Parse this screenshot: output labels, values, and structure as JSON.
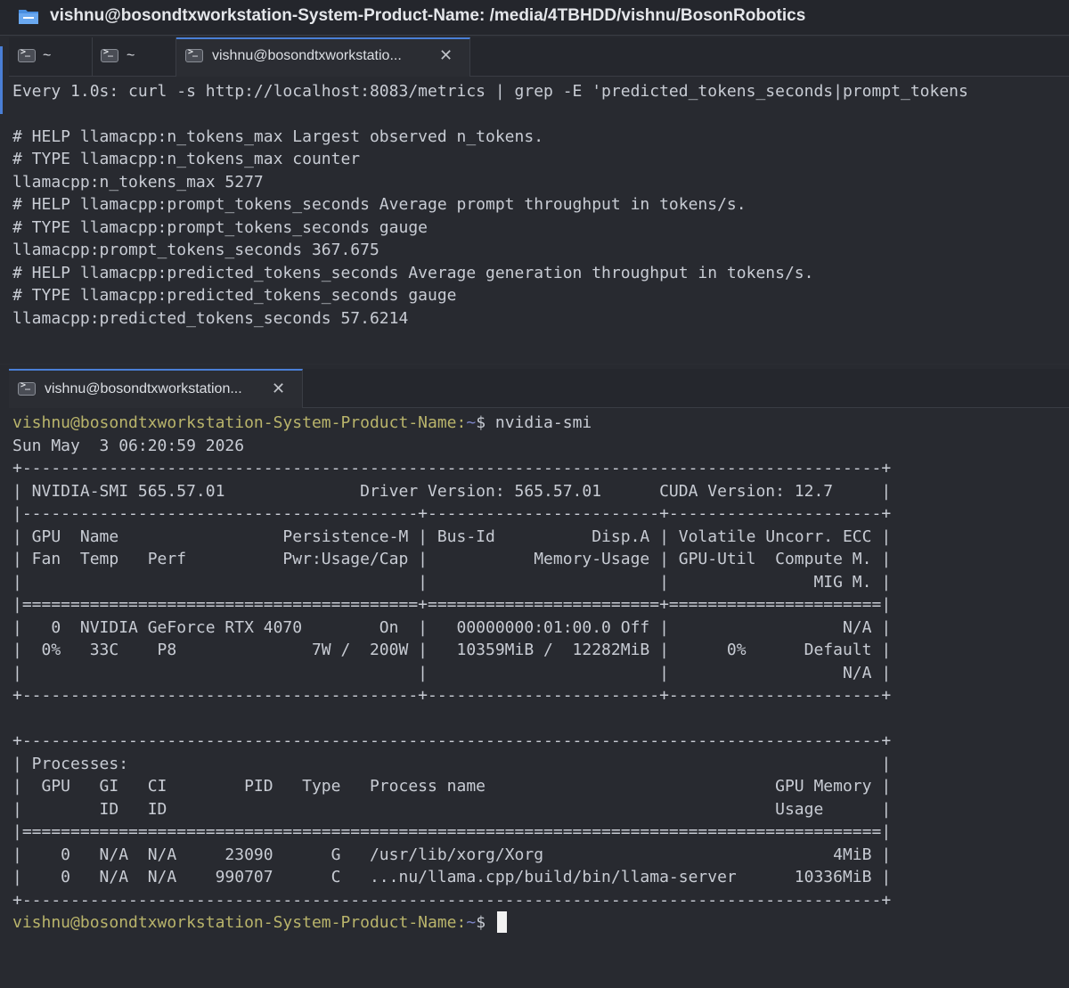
{
  "window": {
    "title": "vishnu@bosondtxworkstation-System-Product-Name: /media/4TBHDD/vishnu/BosonRobotics"
  },
  "top_tabs": [
    {
      "label": "~"
    },
    {
      "label": "~"
    },
    {
      "label": "vishnu@bosondtxworkstatio...",
      "close": "✕"
    }
  ],
  "top_pane": {
    "lines": [
      "Every 1.0s: curl -s http://localhost:8083/metrics | grep -E 'predicted_tokens_seconds|prompt_tokens",
      "",
      "# HELP llamacpp:n_tokens_max Largest observed n_tokens.",
      "# TYPE llamacpp:n_tokens_max counter",
      "llamacpp:n_tokens_max 5277",
      "# HELP llamacpp:prompt_tokens_seconds Average prompt throughput in tokens/s.",
      "# TYPE llamacpp:prompt_tokens_seconds gauge",
      "llamacpp:prompt_tokens_seconds 367.675",
      "# HELP llamacpp:predicted_tokens_seconds Average generation throughput in tokens/s.",
      "# TYPE llamacpp:predicted_tokens_seconds gauge",
      "llamacpp:predicted_tokens_seconds 57.6214"
    ]
  },
  "bottom_tab": {
    "label": "vishnu@bosondtxworkstation...",
    "close": "✕"
  },
  "bottom_pane": {
    "prompt_user": "vishnu@bosondtxworkstation-System-Product-Name",
    "prompt_sep": ":",
    "prompt_path": "~",
    "prompt_symbol": "$ ",
    "command": "nvidia-smi",
    "lines": [
      "Sun May  3 06:20:59 2026",
      "+-----------------------------------------------------------------------------------------+",
      "| NVIDIA-SMI 565.57.01              Driver Version: 565.57.01      CUDA Version: 12.7     |",
      "|-----------------------------------------+------------------------+----------------------+",
      "| GPU  Name                 Persistence-M | Bus-Id          Disp.A | Volatile Uncorr. ECC |",
      "| Fan  Temp   Perf          Pwr:Usage/Cap |           Memory-Usage | GPU-Util  Compute M. |",
      "|                                         |                        |               MIG M. |",
      "|=========================================+========================+======================|",
      "|   0  NVIDIA GeForce RTX 4070        On  |   00000000:01:00.0 Off |                  N/A |",
      "|  0%   33C    P8              7W /  200W |   10359MiB /  12282MiB |      0%      Default |",
      "|                                         |                        |                  N/A |",
      "+-----------------------------------------+------------------------+----------------------+",
      "",
      "",
      "+-----------------------------------------------------------------------------------------+",
      "| Processes:                                                                              |",
      "|  GPU   GI   CI        PID   Type   Process name                              GPU Memory |",
      "|        ID   ID                                                               Usage      |",
      "|=========================================================================================|",
      "|    0   N/A  N/A     23090      G   /usr/lib/xorg/Xorg                              4MiB |",
      "|    0   N/A  N/A    990707      C   ...nu/llama.cpp/build/bin/llama-server      10336MiB |",
      "+-----------------------------------------------------------------------------------------+"
    ]
  }
}
